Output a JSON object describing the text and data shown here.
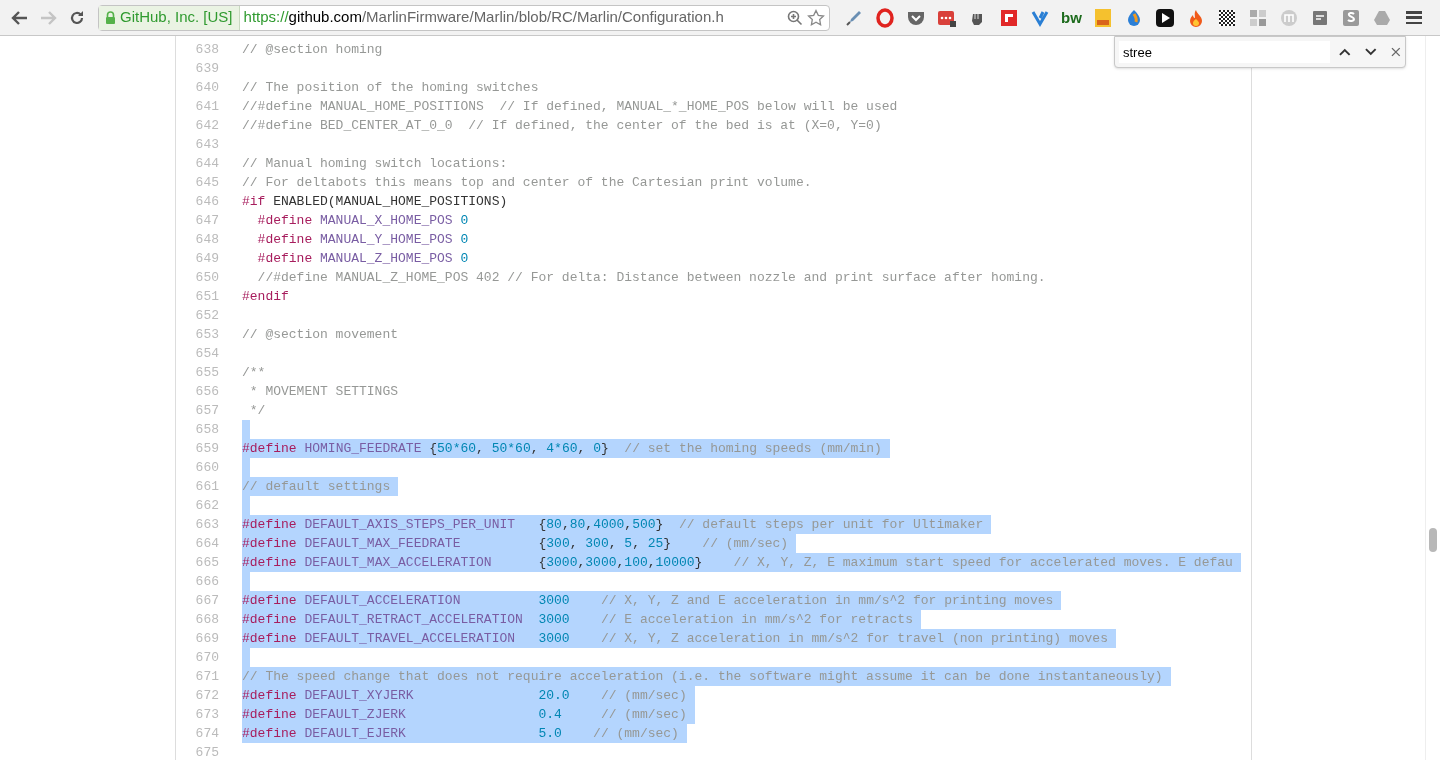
{
  "toolbar": {
    "back_disabled": false,
    "forward_disabled": true,
    "identity": "GitHub, Inc. [US]",
    "url": {
      "scheme": "https://",
      "host": "github.com",
      "path": "/MarlinFirmware/Marlin/blob/RC/Marlin/Configuration.h"
    },
    "extension_label": "bw"
  },
  "find_bar": {
    "value": "stree"
  },
  "code": [
    {
      "number": "638",
      "selected": false,
      "tokens": [
        {
          "kind": "comment",
          "text": "// @section homing"
        }
      ]
    },
    {
      "number": "639",
      "selected": false
    },
    {
      "number": "640",
      "selected": false,
      "tokens": [
        {
          "kind": "comment",
          "text": "// The position of the homing switches"
        }
      ]
    },
    {
      "number": "641",
      "selected": false,
      "tokens": [
        {
          "kind": "comment",
          "text": "//#define MANUAL_HOME_POSITIONS  // If defined, MANUAL_*_HOME_POS below will be used"
        }
      ]
    },
    {
      "number": "642",
      "selected": false,
      "tokens": [
        {
          "kind": "comment",
          "text": "//#define BED_CENTER_AT_0_0  // If defined, the center of the bed is at (X=0, Y=0)"
        }
      ]
    },
    {
      "number": "643",
      "selected": false
    },
    {
      "number": "644",
      "selected": false,
      "tokens": [
        {
          "kind": "comment",
          "text": "// Manual homing switch locations:"
        }
      ]
    },
    {
      "number": "645",
      "selected": false,
      "tokens": [
        {
          "kind": "comment",
          "text": "// For deltabots this means top and center of the Cartesian print volume."
        }
      ]
    },
    {
      "number": "646",
      "selected": false,
      "tokens": [
        {
          "kind": "directive",
          "text": "#if"
        },
        {
          "kind": "plain",
          "text": " ENABLED(MANUAL_HOME_POSITIONS)"
        }
      ]
    },
    {
      "number": "647",
      "selected": false,
      "tokens": [
        {
          "kind": "directive",
          "text": "  #define "
        },
        {
          "kind": "macro",
          "text": "MANUAL_X_HOME_POS "
        },
        {
          "kind": "number",
          "text": "0"
        }
      ]
    },
    {
      "number": "648",
      "selected": false,
      "tokens": [
        {
          "kind": "directive",
          "text": "  #define "
        },
        {
          "kind": "macro",
          "text": "MANUAL_Y_HOME_POS "
        },
        {
          "kind": "number",
          "text": "0"
        }
      ]
    },
    {
      "number": "649",
      "selected": false,
      "tokens": [
        {
          "kind": "directive",
          "text": "  #define "
        },
        {
          "kind": "macro",
          "text": "MANUAL_Z_HOME_POS "
        },
        {
          "kind": "number",
          "text": "0"
        }
      ]
    },
    {
      "number": "650",
      "selected": false,
      "tokens": [
        {
          "kind": "comment",
          "text": "  //#define MANUAL_Z_HOME_POS 402 // For delta: Distance between nozzle and print surface after homing."
        }
      ]
    },
    {
      "number": "651",
      "selected": false,
      "tokens": [
        {
          "kind": "directive",
          "text": "#endif"
        }
      ]
    },
    {
      "number": "652",
      "selected": false
    },
    {
      "number": "653",
      "selected": false,
      "tokens": [
        {
          "kind": "comment",
          "text": "// @section movement"
        }
      ]
    },
    {
      "number": "654",
      "selected": false
    },
    {
      "number": "655",
      "selected": false,
      "tokens": [
        {
          "kind": "comment",
          "text": "/**"
        }
      ]
    },
    {
      "number": "656",
      "selected": false,
      "tokens": [
        {
          "kind": "comment",
          "text": " * MOVEMENT SETTINGS"
        }
      ]
    },
    {
      "number": "657",
      "selected": false,
      "tokens": [
        {
          "kind": "comment",
          "text": " */"
        }
      ]
    },
    {
      "number": "658",
      "selected": true
    },
    {
      "number": "659",
      "selected": true,
      "tokens": [
        {
          "kind": "directive",
          "text": "#define "
        },
        {
          "kind": "macro",
          "text": "HOMING_FEEDRATE"
        },
        {
          "kind": "plain",
          "text": " {"
        },
        {
          "kind": "number",
          "text": "50*60"
        },
        {
          "kind": "plain",
          "text": ", "
        },
        {
          "kind": "number",
          "text": "50*60"
        },
        {
          "kind": "plain",
          "text": ", "
        },
        {
          "kind": "number",
          "text": "4*60"
        },
        {
          "kind": "plain",
          "text": ", "
        },
        {
          "kind": "number",
          "text": "0"
        },
        {
          "kind": "plain",
          "text": "}  "
        },
        {
          "kind": "comment",
          "text": "// set the homing speeds (mm/min)"
        }
      ]
    },
    {
      "number": "660",
      "selected": true
    },
    {
      "number": "661",
      "selected": true,
      "tokens": [
        {
          "kind": "comment",
          "text": "// default settings"
        }
      ]
    },
    {
      "number": "662",
      "selected": true
    },
    {
      "number": "663",
      "selected": true,
      "tokens": [
        {
          "kind": "directive",
          "text": "#define "
        },
        {
          "kind": "macro",
          "text": "DEFAULT_AXIS_STEPS_PER_UNIT"
        },
        {
          "kind": "plain",
          "text": "   {"
        },
        {
          "kind": "number",
          "text": "80"
        },
        {
          "kind": "plain",
          "text": ","
        },
        {
          "kind": "number",
          "text": "80"
        },
        {
          "kind": "plain",
          "text": ","
        },
        {
          "kind": "number",
          "text": "4000"
        },
        {
          "kind": "plain",
          "text": ","
        },
        {
          "kind": "number",
          "text": "500"
        },
        {
          "kind": "plain",
          "text": "}  "
        },
        {
          "kind": "comment",
          "text": "// default steps per unit for Ultimaker"
        }
      ]
    },
    {
      "number": "664",
      "selected": true,
      "tokens": [
        {
          "kind": "directive",
          "text": "#define "
        },
        {
          "kind": "macro",
          "text": "DEFAULT_MAX_FEEDRATE"
        },
        {
          "kind": "plain",
          "text": "          {"
        },
        {
          "kind": "number",
          "text": "300"
        },
        {
          "kind": "plain",
          "text": ", "
        },
        {
          "kind": "number",
          "text": "300"
        },
        {
          "kind": "plain",
          "text": ", "
        },
        {
          "kind": "number",
          "text": "5"
        },
        {
          "kind": "plain",
          "text": ", "
        },
        {
          "kind": "number",
          "text": "25"
        },
        {
          "kind": "plain",
          "text": "}    "
        },
        {
          "kind": "comment",
          "text": "// (mm/sec)"
        }
      ]
    },
    {
      "number": "665",
      "selected": true,
      "tokens": [
        {
          "kind": "directive",
          "text": "#define "
        },
        {
          "kind": "macro",
          "text": "DEFAULT_MAX_ACCELERATION"
        },
        {
          "kind": "plain",
          "text": "      {"
        },
        {
          "kind": "number",
          "text": "3000"
        },
        {
          "kind": "plain",
          "text": ","
        },
        {
          "kind": "number",
          "text": "3000"
        },
        {
          "kind": "plain",
          "text": ","
        },
        {
          "kind": "number",
          "text": "100"
        },
        {
          "kind": "plain",
          "text": ","
        },
        {
          "kind": "number",
          "text": "10000"
        },
        {
          "kind": "plain",
          "text": "}    "
        },
        {
          "kind": "comment",
          "text": "// X, Y, Z, E maximum start speed for accelerated moves. E defau"
        }
      ]
    },
    {
      "number": "666",
      "selected": true
    },
    {
      "number": "667",
      "selected": true,
      "tokens": [
        {
          "kind": "directive",
          "text": "#define "
        },
        {
          "kind": "macro",
          "text": "DEFAULT_ACCELERATION          "
        },
        {
          "kind": "number",
          "text": "3000    "
        },
        {
          "kind": "comment",
          "text": "// X, Y, Z and E acceleration in mm/s^2 for printing moves"
        }
      ]
    },
    {
      "number": "668",
      "selected": true,
      "tokens": [
        {
          "kind": "directive",
          "text": "#define "
        },
        {
          "kind": "macro",
          "text": "DEFAULT_RETRACT_ACCELERATION  "
        },
        {
          "kind": "number",
          "text": "3000    "
        },
        {
          "kind": "comment",
          "text": "// E acceleration in mm/s^2 for retracts"
        }
      ]
    },
    {
      "number": "669",
      "selected": true,
      "tokens": [
        {
          "kind": "directive",
          "text": "#define "
        },
        {
          "kind": "macro",
          "text": "DEFAULT_TRAVEL_ACCELERATION   "
        },
        {
          "kind": "number",
          "text": "3000    "
        },
        {
          "kind": "comment",
          "text": "// X, Y, Z acceleration in mm/s^2 for travel (non printing) moves"
        }
      ]
    },
    {
      "number": "670",
      "selected": true
    },
    {
      "number": "671",
      "selected": true,
      "tokens": [
        {
          "kind": "comment",
          "text": "// The speed change that does not require acceleration (i.e. the software might assume it can be done instantaneously)"
        }
      ]
    },
    {
      "number": "672",
      "selected": true,
      "tokens": [
        {
          "kind": "directive",
          "text": "#define "
        },
        {
          "kind": "macro",
          "text": "DEFAULT_XYJERK                "
        },
        {
          "kind": "number",
          "text": "20.0    "
        },
        {
          "kind": "comment",
          "text": "// (mm/sec)"
        }
      ]
    },
    {
      "number": "673",
      "selected": true,
      "tokens": [
        {
          "kind": "directive",
          "text": "#define "
        },
        {
          "kind": "macro",
          "text": "DEFAULT_ZJERK                 "
        },
        {
          "kind": "number",
          "text": "0.4     "
        },
        {
          "kind": "comment",
          "text": "// (mm/sec)"
        }
      ]
    },
    {
      "number": "674",
      "selected": true,
      "tokens": [
        {
          "kind": "directive",
          "text": "#define "
        },
        {
          "kind": "macro",
          "text": "DEFAULT_EJERK                 "
        },
        {
          "kind": "number",
          "text": "5.0    "
        },
        {
          "kind": "comment",
          "text": "// (mm/sec)"
        }
      ]
    },
    {
      "number": "675",
      "selected": false
    }
  ]
}
